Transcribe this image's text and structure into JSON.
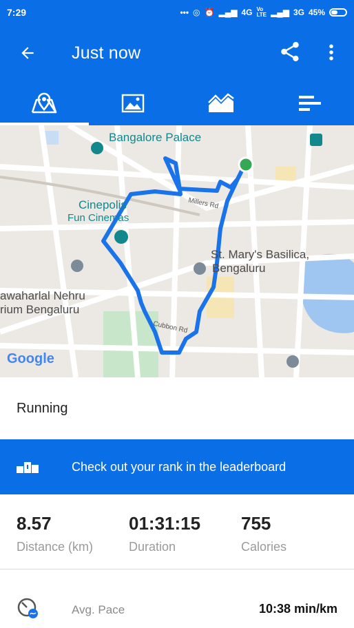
{
  "status_bar": {
    "time": "7:29",
    "network_1": "4G",
    "network_2": "3G",
    "battery": "45%"
  },
  "app_bar": {
    "title": "Just now",
    "icons": [
      "back-arrow-icon",
      "share-icon",
      "more-vert-icon"
    ]
  },
  "tabs": [
    {
      "icon": "map-tab-icon",
      "active": true
    },
    {
      "icon": "photos-tab-icon",
      "active": false
    },
    {
      "icon": "chart-tab-icon",
      "active": false
    },
    {
      "icon": "splits-tab-icon",
      "active": false
    }
  ],
  "map": {
    "labels": {
      "palace": "Bangalore Palace",
      "cinepolis_1": "Cinepolis",
      "cinepolis_2": "Fun Cinemas",
      "basilica_1": "St. Mary's Basilica,",
      "basilica_2": "Bengaluru",
      "stadium_1": "awaharlal Nehru",
      "stadium_2": "rium Bengaluru",
      "millers": "Millers Rd",
      "cubbon": "Cubbon Rd",
      "google": "Google"
    },
    "colors": {
      "route": "#1a73e8",
      "start_dot": "#34a853"
    }
  },
  "activity_type": "Running",
  "leaderboard_text": "Check out your rank in the leaderboard",
  "stats": {
    "distance": {
      "value": "8.57",
      "label": "Distance (km)"
    },
    "duration": {
      "value": "01:31:15",
      "label": "Duration"
    },
    "calories": {
      "value": "755",
      "label": "Calories"
    }
  },
  "pace": {
    "label": "Avg. Pace",
    "value": "10:38 min/km"
  },
  "colors": {
    "primary": "#0a6fe6"
  }
}
